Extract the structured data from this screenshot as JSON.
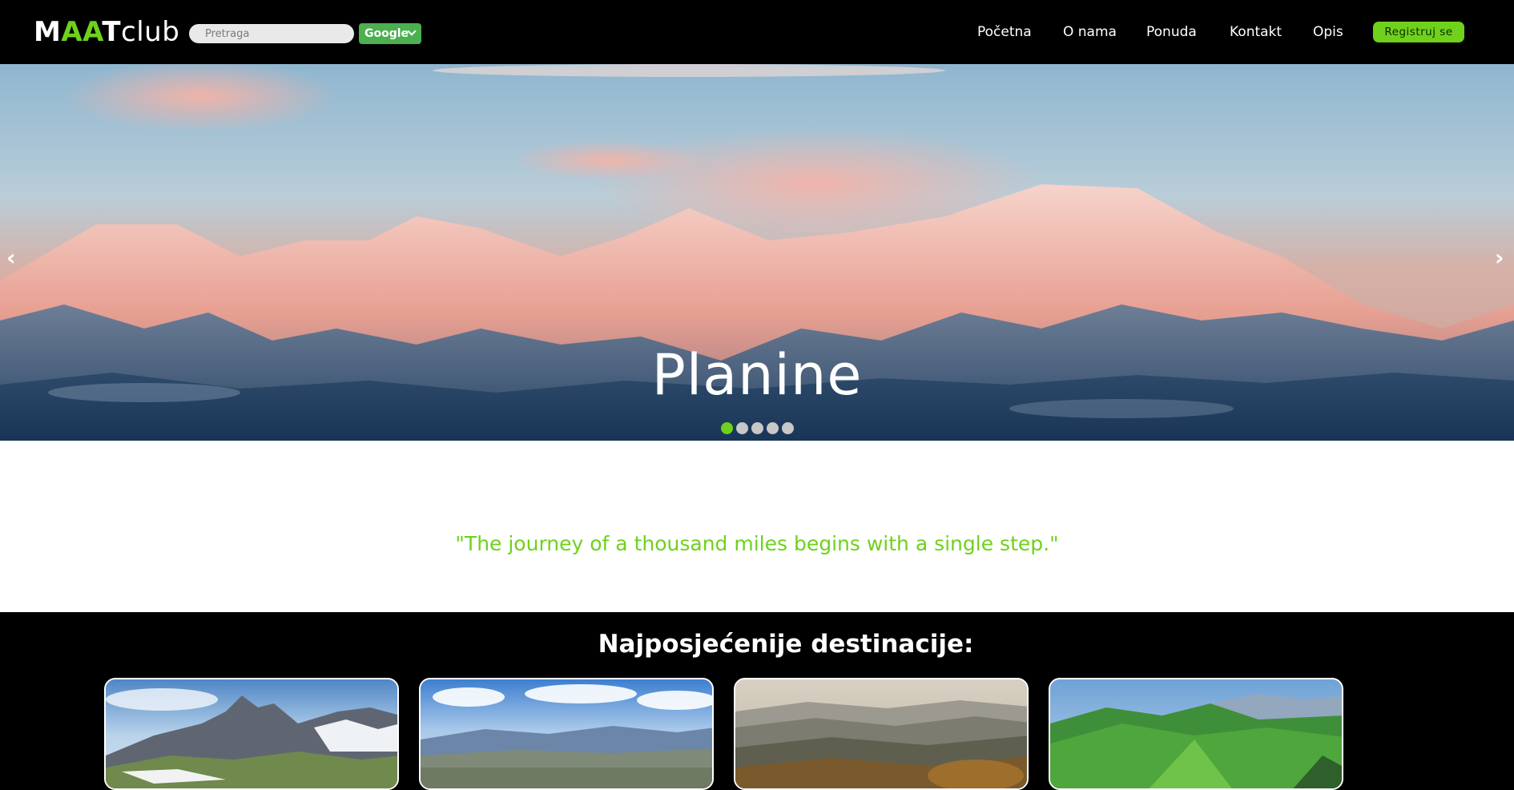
{
  "navbar": {
    "logo": {
      "m": "M",
      "aa": "AA",
      "t": "T",
      "club": "club"
    },
    "search": {
      "placeholder": "Pretraga"
    },
    "engine": {
      "selected": "Google"
    },
    "links": [
      "Početna",
      "O nama",
      "Ponuda",
      "Kontakt",
      "Opis"
    ],
    "register_label": "Registruj se"
  },
  "hero": {
    "title": "Planine",
    "prev_arrow": "‹",
    "next_arrow": "›",
    "slide_count": 5,
    "active_slide": 1
  },
  "quote": {
    "text": "\"The journey of a thousand miles begins with a single step.\""
  },
  "destinations": {
    "heading": "Najposjećenije destinacije:",
    "cards": [
      {
        "image": "rocky-peak-snow"
      },
      {
        "image": "plateau-blue-sky"
      },
      {
        "image": "misty-autumn-hills"
      },
      {
        "image": "green-valley"
      }
    ]
  },
  "colors": {
    "accent": "#6fd11c",
    "engine": "#4caf50",
    "nav_bg": "#000000"
  }
}
